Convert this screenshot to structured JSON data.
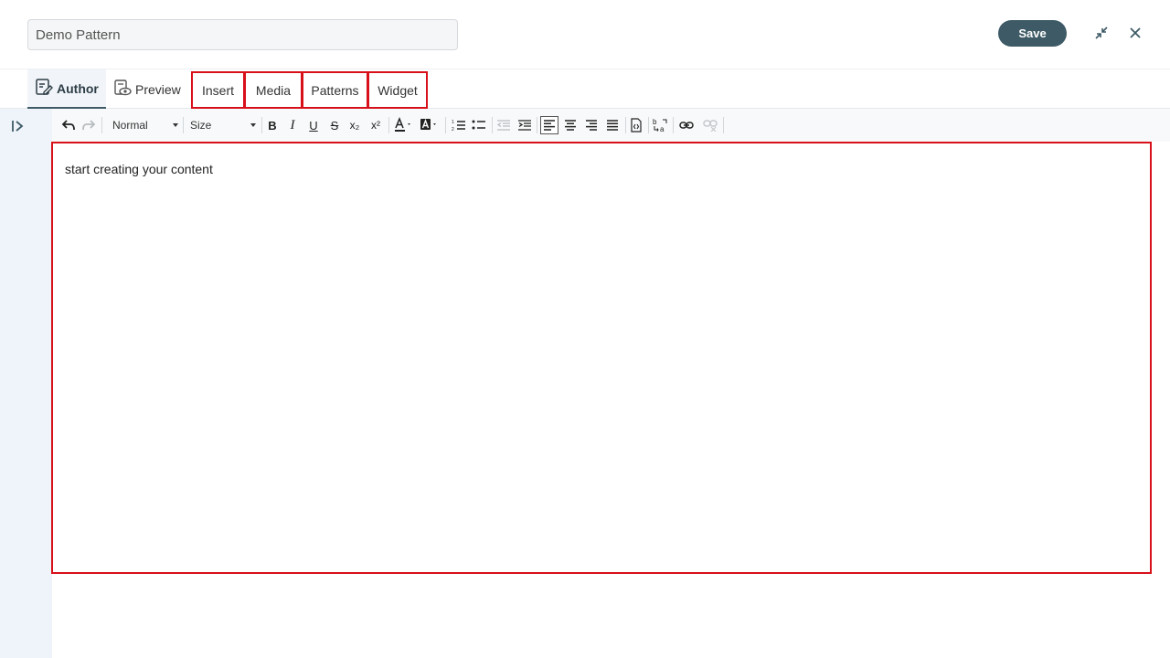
{
  "header": {
    "title_value": "Demo Pattern",
    "save_label": "Save",
    "icons": {
      "collapse": "collapse-arrows-icon",
      "close": "close-icon"
    }
  },
  "tabs": {
    "author": "Author",
    "preview": "Preview",
    "insert": "Insert",
    "media": "Media",
    "patterns": "Patterns",
    "widget": "Widget"
  },
  "toolbar": {
    "format_select": "Normal",
    "size_select": "Size",
    "bold": "B",
    "italic": "I",
    "underline": "U",
    "strike": "S",
    "subscript": "x₂",
    "superscript": "x²"
  },
  "editor": {
    "content": "start creating your content"
  },
  "colors": {
    "accent": "#3d5a66",
    "highlight_border": "#d7101a",
    "sidebar_bg": "#eef4fa"
  }
}
